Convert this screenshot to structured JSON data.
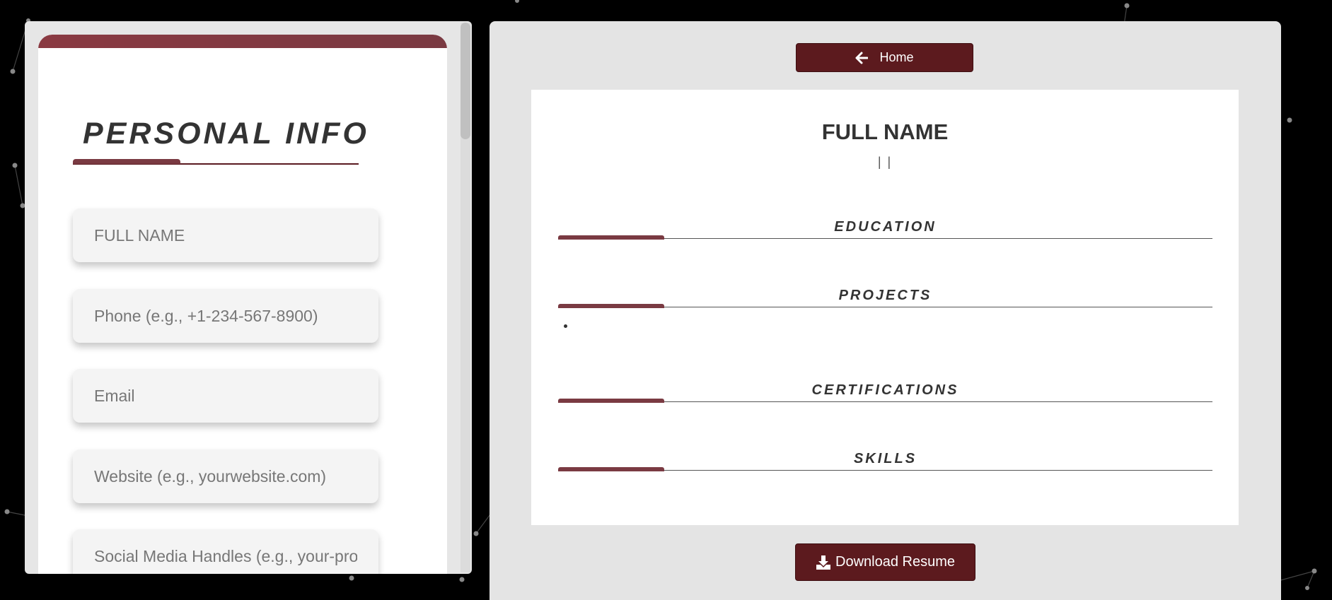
{
  "personal_info": {
    "title": "PERSONAL INFO",
    "fields": [
      {
        "name": "full-name-field",
        "placeholder": "FULL NAME",
        "value": ""
      },
      {
        "name": "phone-field",
        "placeholder": "Phone (e.g., +1-234-567-8900)",
        "value": ""
      },
      {
        "name": "email-field",
        "placeholder": "Email",
        "value": ""
      },
      {
        "name": "website-field",
        "placeholder": "Website (e.g., yourwebsite.com)",
        "value": ""
      },
      {
        "name": "social-media-field",
        "placeholder": "Social Media Handles (e.g., your-profile)",
        "value": ""
      }
    ]
  },
  "preview": {
    "home_label": "Home",
    "full_name": "FULL NAME",
    "contact_line": "| |",
    "sections": [
      "EDUCATION",
      "PROJECTS",
      "CERTIFICATIONS",
      "SKILLS"
    ],
    "download_label": "Download Resume"
  },
  "colors": {
    "accent": "#7a3a42",
    "button": "#5c1a1e",
    "panel": "#e4e4e4"
  }
}
